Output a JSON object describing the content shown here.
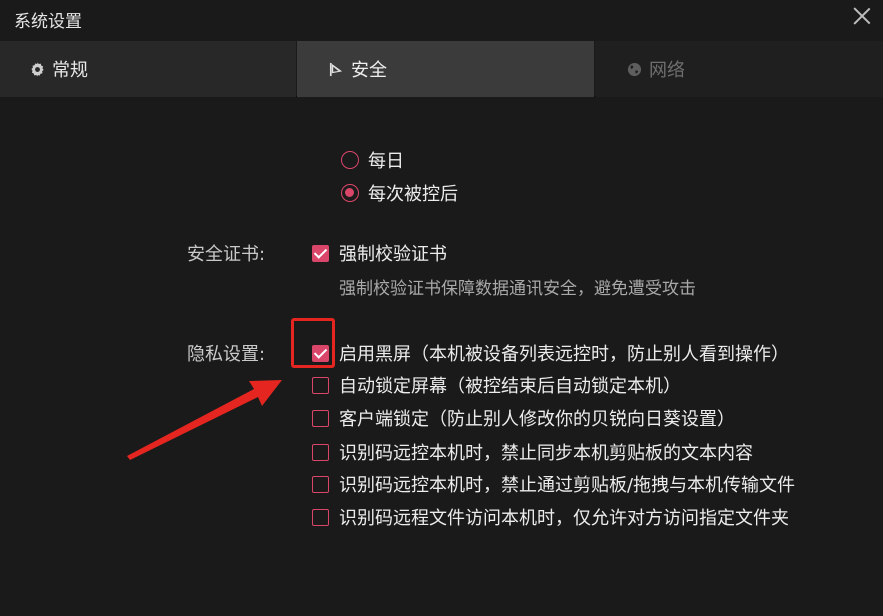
{
  "window": {
    "title": "系统设置"
  },
  "tabs": [
    {
      "label": "常规",
      "icon": "gear-icon",
      "state": "inactive"
    },
    {
      "label": "安全",
      "icon": "flag-icon",
      "state": "selected"
    },
    {
      "label": "网络",
      "icon": "globe-icon",
      "state": "disabled"
    }
  ],
  "schedule": {
    "options": [
      {
        "label": "每日",
        "checked": false
      },
      {
        "label": "每次被控后",
        "checked": true
      }
    ]
  },
  "certificate": {
    "label": "安全证书:",
    "option": {
      "label": "强制校验证书",
      "checked": true
    },
    "description": "强制校验证书保障数据通讯安全，避免遭受攻击"
  },
  "privacy": {
    "label": "隐私设置:",
    "options": [
      {
        "label": "启用黑屏（本机被设备列表远控时，防止别人看到操作）",
        "checked": true
      },
      {
        "label": "自动锁定屏幕（被控结束后自动锁定本机）",
        "checked": false
      },
      {
        "label": "客户端锁定（防止别人修改你的贝锐向日葵设置）",
        "checked": false
      },
      {
        "label": "识别码远控本机时，禁止同步本机剪贴板的文本内容",
        "checked": false
      },
      {
        "label": "识别码远控本机时，禁止通过剪贴板/拖拽与本机传输文件",
        "checked": false
      },
      {
        "label": "识别码远程文件访问本机时，仅允许对方访问指定文件夹",
        "checked": false
      }
    ]
  },
  "colors": {
    "accent": "#d9466a",
    "annotation": "#e52620",
    "background": "#1a1a1a"
  }
}
